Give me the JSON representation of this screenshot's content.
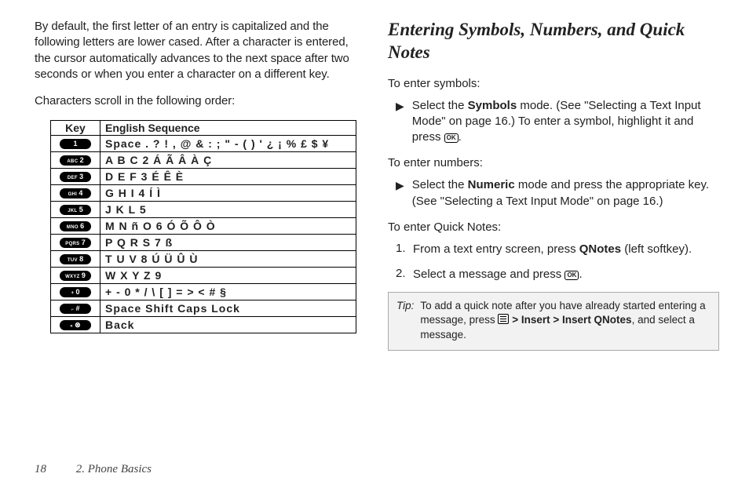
{
  "left": {
    "p1": "By default, the first letter of an entry is capitalized and the following letters are lower cased. After a character is entered, the cursor automatically advances to the next space after two seconds or when you enter a character on a different key.",
    "p2": "Characters scroll in the following order:",
    "table": {
      "head_key": "Key",
      "head_seq": "English Sequence",
      "rows": [
        {
          "key_small": "",
          "key_big": "1",
          "seq": "Space . ? ! , @ & : ; \" - ( ) ' ¿ ¡ % £ $ ¥"
        },
        {
          "key_small": "ABC",
          "key_big": "2",
          "seq": "A B C 2 Á Ã Â À Ç"
        },
        {
          "key_small": "DEF",
          "key_big": "3",
          "seq": "D E F 3 É Ê È"
        },
        {
          "key_small": "GHI",
          "key_big": "4",
          "seq": "G H I 4 Í Ì"
        },
        {
          "key_small": "JKL",
          "key_big": "5",
          "seq": "J K L 5"
        },
        {
          "key_small": "MNO",
          "key_big": "6",
          "seq": "M N ñ O 6 Ó Õ Ô Ò"
        },
        {
          "key_small": "PQRS",
          "key_big": "7",
          "seq": "P Q R S 7 ß"
        },
        {
          "key_small": "TUV",
          "key_big": "8",
          "seq": "T U V 8 Ú Ü Û Ù"
        },
        {
          "key_small": "WXYZ",
          "key_big": "9",
          "seq": "W X Y Z 9"
        },
        {
          "key_small": "+",
          "key_big": "0",
          "seq": "+ - 0 * / \\ [ ] = > < # §"
        },
        {
          "key_small": "⌐",
          "key_big": "#",
          "seq": "Space    Shift    Caps Lock"
        },
        {
          "key_small": "«",
          "key_big": "⊗",
          "seq": "Back"
        }
      ]
    }
  },
  "right": {
    "heading": "Entering Symbols, Numbers, and Quick Notes",
    "sym_lead": "To enter symbols:",
    "sym_bullet_a": "Select the ",
    "sym_bullet_b": "Symbols",
    "sym_bullet_c": " mode. (See \"Selecting a Text Input Mode\" on page 16.) To enter a symbol, highlight it and press ",
    "ok_label": "OK",
    "num_lead": "To enter numbers:",
    "num_bullet_a": "Select the ",
    "num_bullet_b": "Numeric",
    "num_bullet_c": " mode and press the appropriate key. (See \"Selecting a Text Input Mode\" on page 16.)",
    "qn_lead": "To enter Quick Notes:",
    "qn_step1_a": "From a text entry screen, press ",
    "qn_step1_b": "QNotes",
    "qn_step1_c": " (left softkey).",
    "qn_step2_a": "Select a message and press ",
    "tip_label": "Tip:",
    "tip_a": "To add a quick note after you have already started entering a message, press ",
    "tip_gt": ">",
    "tip_insert": "Insert",
    "tip_insertq": "Insert QNotes",
    "tip_end": ", and select a message."
  },
  "footer": {
    "page": "18",
    "chapter": "2. Phone Basics"
  }
}
